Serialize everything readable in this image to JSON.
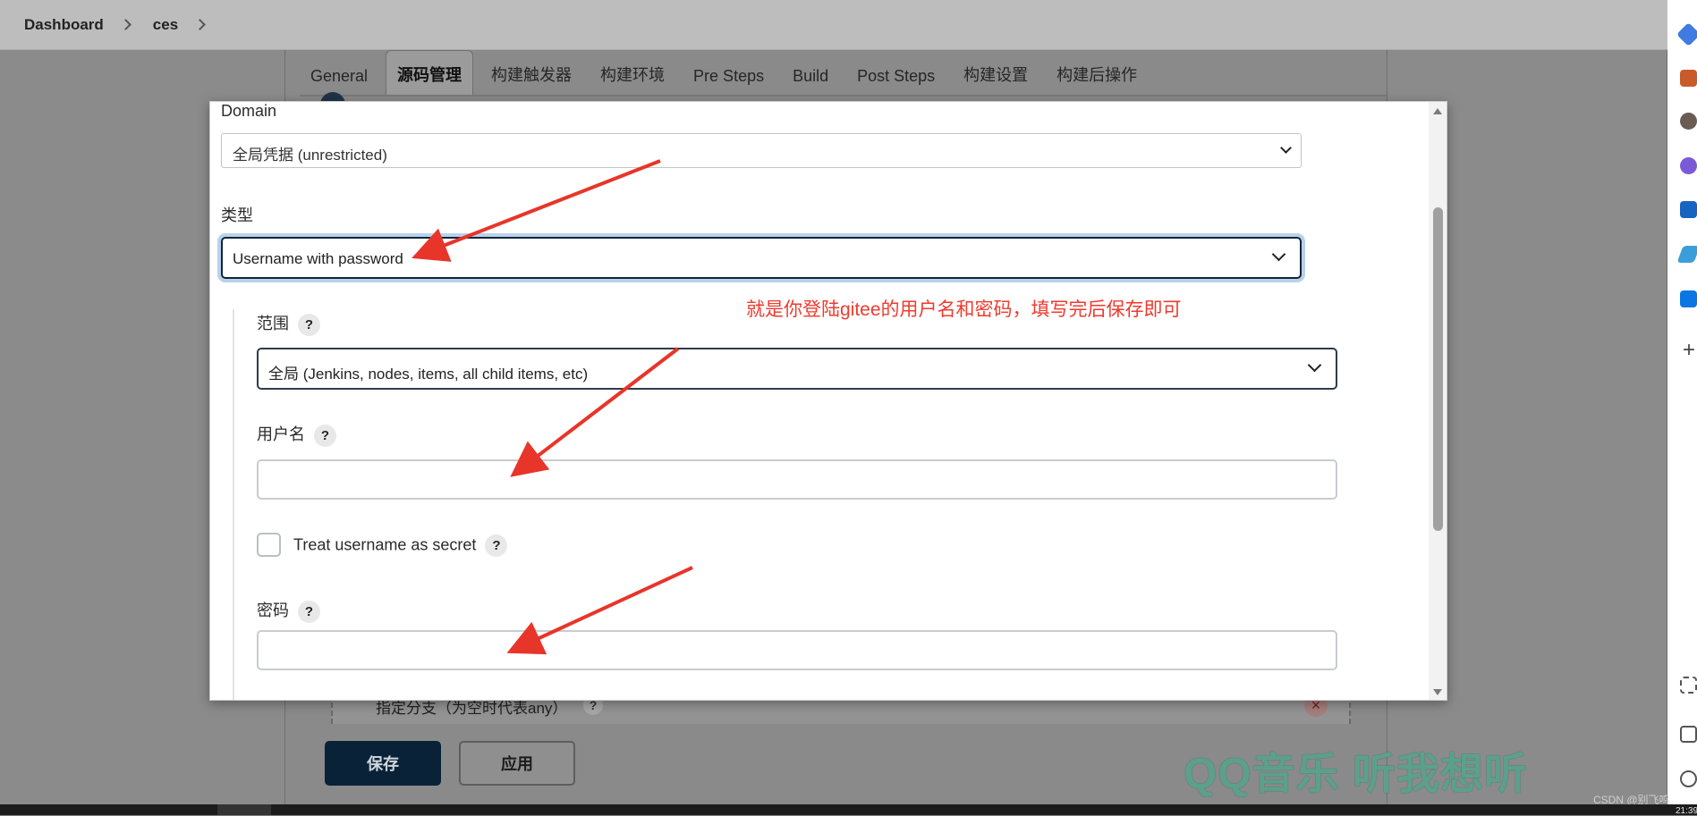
{
  "breadcrumb": {
    "items": [
      "Dashboard",
      "ces"
    ]
  },
  "tabs": [
    "General",
    "源码管理",
    "构建触发器",
    "构建环境",
    "Pre Steps",
    "Build",
    "Post Steps",
    "构建设置",
    "构建后操作"
  ],
  "active_tab": "源码管理",
  "background": {
    "branch_label": "指定分支（为空时代表any）",
    "save_label": "保存",
    "apply_label": "应用",
    "help_mark": "?",
    "delete_mark": "×"
  },
  "modal": {
    "domain_label": "Domain",
    "domain_value": "全局凭据 (unrestricted)",
    "type_label": "类型",
    "type_value": "Username with password",
    "scope_label": "范围",
    "scope_value": "全局 (Jenkins, nodes, items, all child items, etc)",
    "username_label": "用户名",
    "username_value": "",
    "treat_secret_label": "Treat username as secret",
    "password_label": "密码",
    "password_value": "",
    "help_mark": "?",
    "annotation": "就是你登陆gitee的用户名和密码，填写完后保存即可"
  },
  "watermark": "QQ音乐 听我想听",
  "csdn_mark": "CSDN @别飞鸣",
  "clock_partial": "21:39",
  "colors": {
    "primary_button": "#0a2238",
    "annotation_red": "#f03a2e",
    "focus_ring": "#b9d2ea",
    "watermark_green": "#5ca08c"
  },
  "icons": [
    "chevron-right-icon",
    "chevron-down-icon",
    "help-icon",
    "checkbox-icon",
    "scroll-up-icon",
    "scroll-down-icon",
    "plus-icon",
    "gear-icon",
    "settings-icon"
  ]
}
